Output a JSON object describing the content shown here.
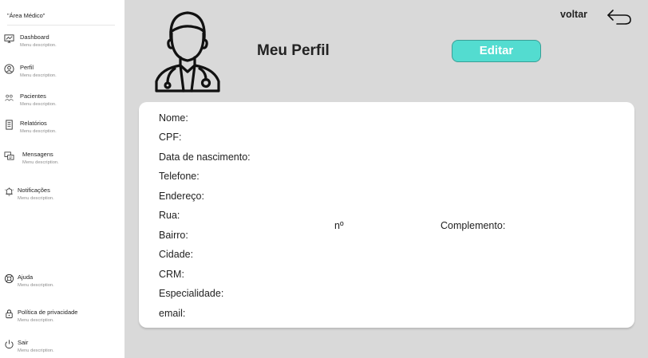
{
  "app": {
    "title": "\"Área Médico\""
  },
  "sidebar": {
    "items": [
      {
        "label": "Dashboard",
        "desc": "Menu description."
      },
      {
        "label": "Perfil",
        "desc": "Menu description."
      },
      {
        "label": "Pacientes",
        "desc": "Menu description."
      },
      {
        "label": "Relatórios",
        "desc": "Menu description."
      },
      {
        "label": "Mensagens",
        "desc": "Menu description."
      },
      {
        "label": "Notificações",
        "desc": "Menu description."
      },
      {
        "label": "Ajuda",
        "desc": "Menu description."
      },
      {
        "label": "Política de privacidade",
        "desc": "Menu description."
      },
      {
        "label": "Sair",
        "desc": "Menu description."
      }
    ],
    "icons": [
      "monitor-icon",
      "user-circle-icon",
      "users-icon",
      "report-icon",
      "chat-icon",
      "bell-icon",
      "help-icon",
      "lock-icon",
      "power-icon"
    ]
  },
  "header": {
    "title": "Meu Perfil",
    "edit_label": "Editar",
    "back_label": "voltar"
  },
  "profile": {
    "fields": [
      "Nome:",
      "CPF:",
      "Data de nascimento:",
      "Telefone:",
      "Endereço:",
      "Rua:",
      "Bairro:",
      "Cidade:",
      "CRM:",
      "Especialidade:",
      "email:"
    ],
    "number_label": "nº",
    "complement_label": "Complemento:"
  },
  "colors": {
    "accent": "#53dcd0",
    "background": "#d9d9d9",
    "card": "#ffffff"
  }
}
